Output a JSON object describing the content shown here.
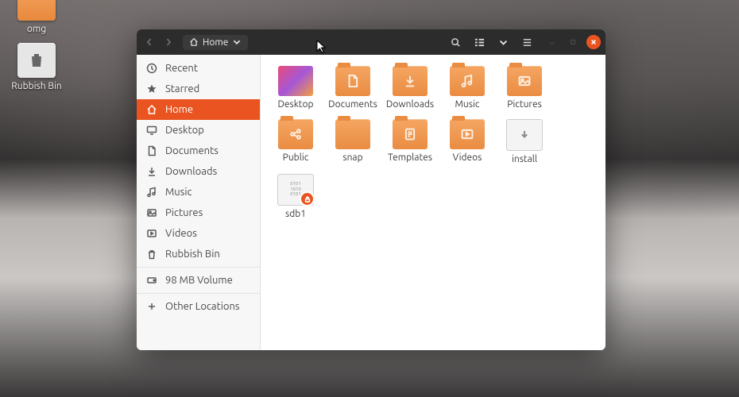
{
  "desktop_icons": [
    {
      "id": "omg",
      "label": "omg",
      "kind": "folder"
    },
    {
      "id": "rubbish",
      "label": "Rubbish Bin",
      "kind": "trash"
    }
  ],
  "path": {
    "location": "Home"
  },
  "sidebar": [
    {
      "id": "recent",
      "label": "Recent",
      "icon": "clock",
      "active": false
    },
    {
      "id": "starred",
      "label": "Starred",
      "icon": "star",
      "active": false
    },
    {
      "id": "home",
      "label": "Home",
      "icon": "home",
      "active": true
    },
    {
      "id": "desktop",
      "label": "Desktop",
      "icon": "desktop",
      "active": false
    },
    {
      "id": "documents",
      "label": "Documents",
      "icon": "doc",
      "active": false
    },
    {
      "id": "downloads",
      "label": "Downloads",
      "icon": "down",
      "active": false
    },
    {
      "id": "music",
      "label": "Music",
      "icon": "music",
      "active": false
    },
    {
      "id": "pictures",
      "label": "Pictures",
      "icon": "pic",
      "active": false
    },
    {
      "id": "videos",
      "label": "Videos",
      "icon": "vid",
      "active": false
    },
    {
      "id": "rubbish",
      "label": "Rubbish Bin",
      "icon": "trash",
      "active": false
    },
    {
      "id": "vol",
      "label": "98 MB Volume",
      "icon": "vol",
      "active": false,
      "sep": true
    },
    {
      "id": "other",
      "label": "Other Locations",
      "icon": "plus",
      "active": false,
      "sep": true
    }
  ],
  "files": [
    {
      "id": "desktop",
      "label": "Desktop",
      "kind": "desktop"
    },
    {
      "id": "documents",
      "label": "Documents",
      "kind": "folder",
      "glyph": "doc"
    },
    {
      "id": "downloads",
      "label": "Downloads",
      "kind": "folder",
      "glyph": "down"
    },
    {
      "id": "music",
      "label": "Music",
      "kind": "folder",
      "glyph": "music"
    },
    {
      "id": "pictures",
      "label": "Pictures",
      "kind": "folder",
      "glyph": "pic"
    },
    {
      "id": "public",
      "label": "Public",
      "kind": "folder",
      "glyph": "share"
    },
    {
      "id": "snap",
      "label": "snap",
      "kind": "folder"
    },
    {
      "id": "templates",
      "label": "Templates",
      "kind": "folder",
      "glyph": "tpl"
    },
    {
      "id": "videos",
      "label": "Videos",
      "kind": "folder",
      "glyph": "vid"
    },
    {
      "id": "install",
      "label": "install",
      "kind": "script"
    },
    {
      "id": "sdb1",
      "label": "sdb1",
      "kind": "drive",
      "locked": true
    }
  ]
}
